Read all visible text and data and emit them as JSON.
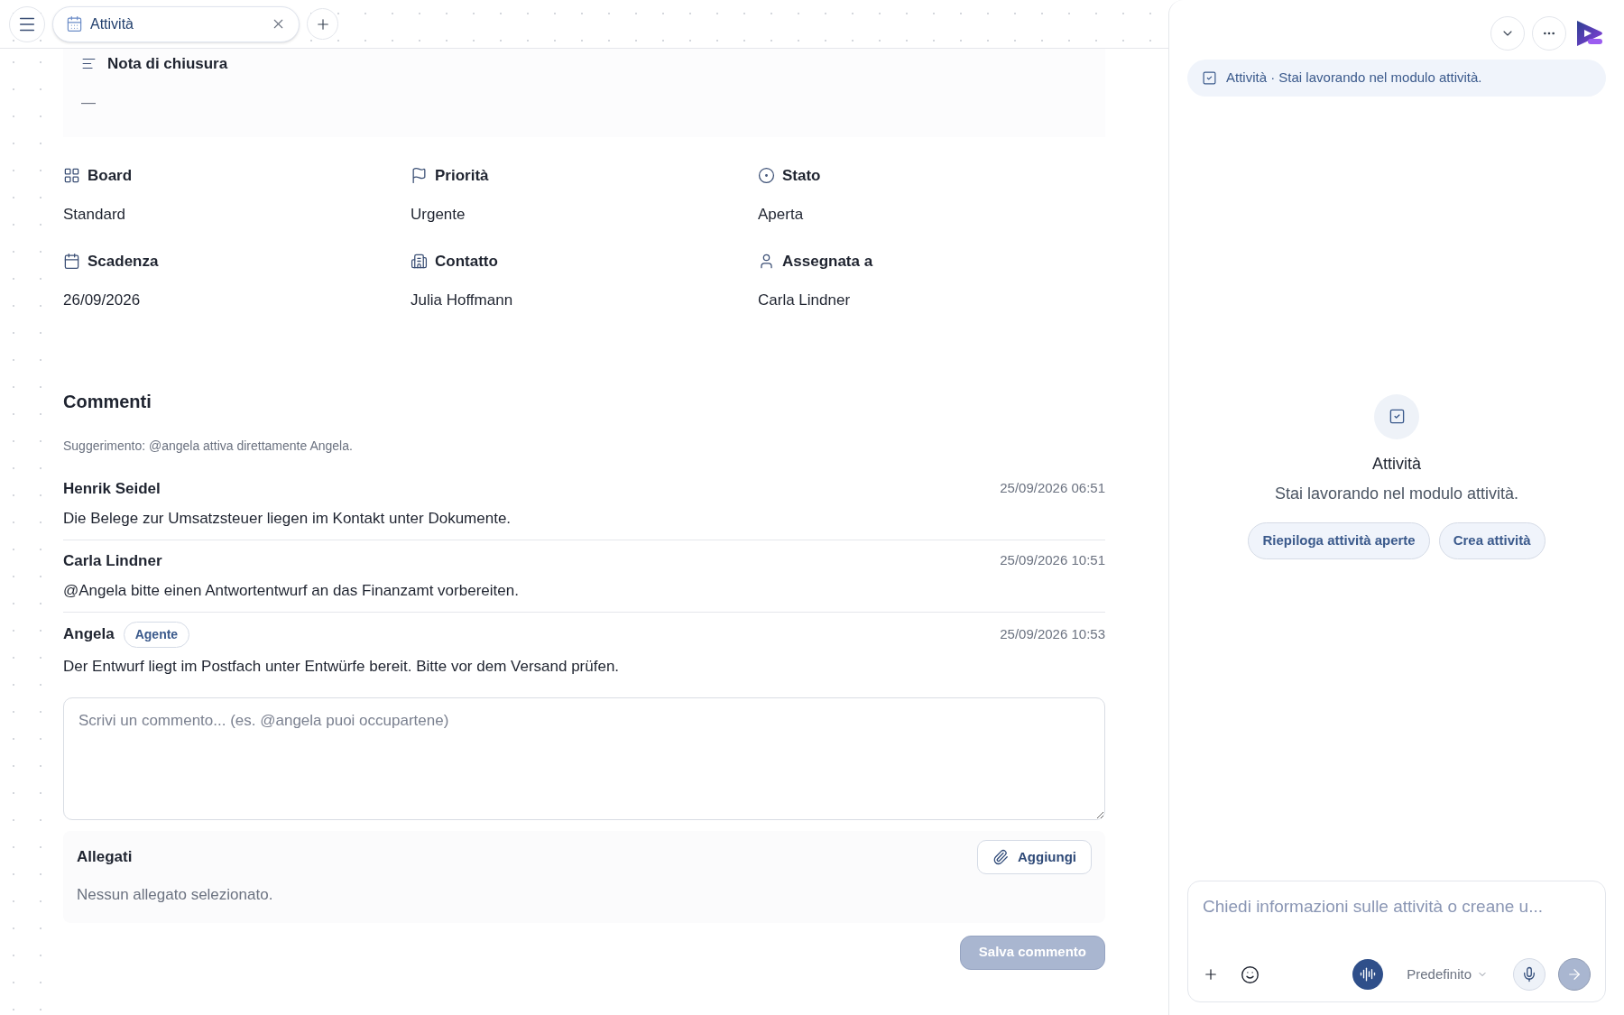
{
  "top_bar": {
    "tabs": [
      {
        "label": "Attività",
        "selected": true
      }
    ]
  },
  "closing_note": {
    "label": "Nota di chiusura",
    "value": "—"
  },
  "fields": [
    {
      "kind": "board",
      "label": "Board",
      "value": "Standard"
    },
    {
      "kind": "priority",
      "label": "Priorità",
      "value": "Urgente"
    },
    {
      "kind": "status",
      "label": "Stato",
      "value": "Aperta"
    },
    {
      "kind": "due",
      "label": "Scadenza",
      "value": "26/09/2026"
    },
    {
      "kind": "contact",
      "label": "Contatto",
      "value": "Julia Hoffmann"
    },
    {
      "kind": "assignee",
      "label": "Assegnata a",
      "value": "Carla Lindner"
    }
  ],
  "comments": {
    "title": "Commenti",
    "hint": "Suggerimento: @angela attiva direttamente Angela.",
    "items": [
      {
        "author": "Henrik Seidel",
        "time": "25/09/2026 06:51",
        "text": "Die Belege zur Umsatzsteuer liegen im Kontakt unter Dokumente."
      },
      {
        "author": "Carla Lindner",
        "time": "25/09/2026 10:51",
        "text": "@Angela bitte einen Antwortentwurf an das Finanzamt vorbereiten."
      },
      {
        "author": "Angela",
        "badge": "Agente",
        "time": "25/09/2026 10:53",
        "text": "Der Entwurf liegt im Postfach unter Entwürfe bereit. Bitte vor dem Versand prüfen."
      }
    ],
    "input": {
      "placeholder": "Scrivi un commento... (es. @angela puoi occupartene)"
    },
    "attachments": {
      "title": "Allegati",
      "button": "Aggiungi",
      "empty": "Nessun allegato selezionato."
    },
    "save_button": {
      "label": "Salva commento",
      "disabled": true
    }
  },
  "assistant": {
    "context_banner": "Attività · Stai lavorando nel modulo attività.",
    "empty_state": {
      "title": "Attività",
      "subtitle": "Stai lavorando nel modulo attività.",
      "suggestions": [
        "Riepiloga attività aperte",
        "Crea attività"
      ]
    },
    "composer": {
      "placeholder": "Chiedi informazioni sulle attività o creane u...",
      "mode": "Predefinito",
      "send_disabled": true
    }
  }
}
